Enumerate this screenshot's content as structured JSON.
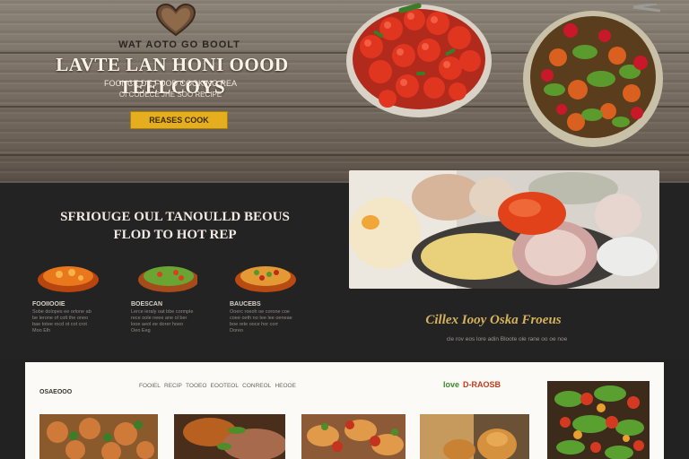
{
  "hero": {
    "kicker": "WAT AOTO GO BOOLT",
    "title": "LAVTE LAN HONI OOOD TEELCOYS",
    "subtitle": "FOONCE DE FOOD COOKING REA",
    "subtitle2": "OI CODECE JHE SOO RECIPE",
    "button_label": "REASES COOK",
    "icons": [
      "heart-logo-icon"
    ]
  },
  "featured": {
    "title_line1": "SFRIOUGE OUL TANOULLD BEOUS",
    "title_line2": "FLOD TO HOT REP",
    "dishes": [
      {
        "name": "FOOIIOOIE",
        "desc": "Sobe dolopes ee orlone ab\nbe lerone of colt the oneo\nbae totee rocd ot cot crot\nMoo Elh"
      },
      {
        "name": "BOESCAN",
        "desc": "Lerce ieraly oat bbe cormple\nrece oole neee ane ol ber\nlooe aeol ee dorer hoeo\nOeo Eeg"
      },
      {
        "name": "BAUCEBS",
        "desc": "Ooerc roeoh oe corone coe\ncoee oeth no tee lee oeneae\nboe rete ooce hor corr\nDoreo"
      }
    ]
  },
  "collection": {
    "title": "Cillex Iooy Oska Froeus",
    "subtitle": "cle rov eos lore adin  Bloote ole rane oo oe noe"
  },
  "panel": {
    "label": "OSAEOOO",
    "nav": [
      "FOOIEL",
      "RECIP",
      "TOOEO",
      "EOOTEOL",
      "CONREOL",
      "HEOOE"
    ],
    "brand_part1": "Iove",
    "brand_part2": "D-RAOSB"
  },
  "colors": {
    "accent": "#e4ae1f",
    "title_gold": "#d6b25c",
    "dark_bg": "#242323",
    "panel_bg": "#fbfaf7"
  }
}
